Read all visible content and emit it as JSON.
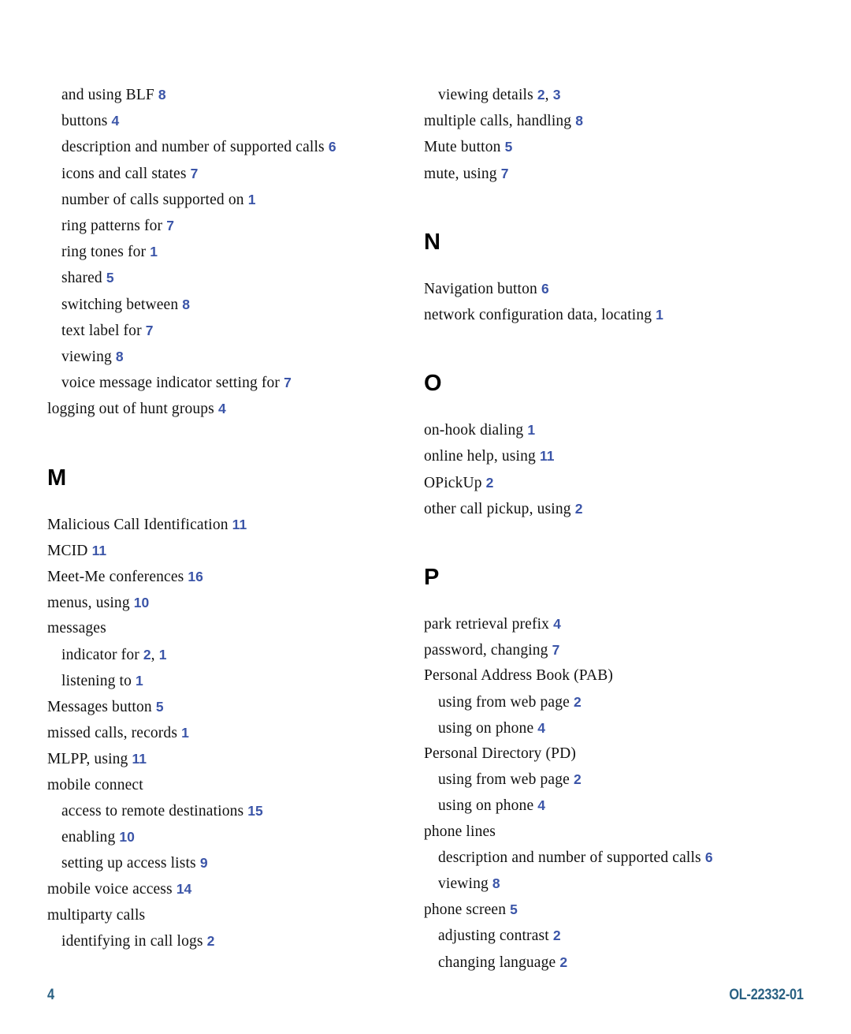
{
  "document": {
    "type": "index",
    "footer": {
      "page_number": "4",
      "document_id": "OL-22332-01"
    },
    "colors": {
      "page_reference": "#3b55a8",
      "footer": "#2a6183",
      "body_text": "#111111",
      "heading": "#000000"
    }
  },
  "columns": {
    "left": [
      {
        "kind": "entry",
        "level": 2,
        "term": "and using BLF",
        "refs": [
          "8"
        ]
      },
      {
        "kind": "entry",
        "level": 2,
        "term": "buttons",
        "refs": [
          "4"
        ]
      },
      {
        "kind": "entry",
        "level": 2,
        "term": "description and number of supported calls",
        "refs": [
          "6"
        ]
      },
      {
        "kind": "entry",
        "level": 2,
        "term": "icons and call states",
        "refs": [
          "7"
        ]
      },
      {
        "kind": "entry",
        "level": 2,
        "term": "number of calls supported on",
        "refs": [
          "1"
        ]
      },
      {
        "kind": "entry",
        "level": 2,
        "term": "ring patterns for",
        "refs": [
          "7"
        ]
      },
      {
        "kind": "entry",
        "level": 2,
        "term": "ring tones for",
        "refs": [
          "1"
        ]
      },
      {
        "kind": "entry",
        "level": 2,
        "term": "shared",
        "refs": [
          "5"
        ]
      },
      {
        "kind": "entry",
        "level": 2,
        "term": "switching between",
        "refs": [
          "8"
        ]
      },
      {
        "kind": "entry",
        "level": 2,
        "term": "text label for",
        "refs": [
          "7"
        ]
      },
      {
        "kind": "entry",
        "level": 2,
        "term": "viewing",
        "refs": [
          "8"
        ]
      },
      {
        "kind": "entry",
        "level": 2,
        "term": "voice message indicator setting for",
        "refs": [
          "7"
        ]
      },
      {
        "kind": "entry",
        "level": 1,
        "term": "logging out of hunt groups",
        "refs": [
          "4"
        ]
      },
      {
        "kind": "heading",
        "letter": "M"
      },
      {
        "kind": "entry",
        "level": 1,
        "term": "Malicious Call Identification",
        "refs": [
          "11"
        ]
      },
      {
        "kind": "entry",
        "level": 1,
        "term": "MCID",
        "refs": [
          "11"
        ]
      },
      {
        "kind": "entry",
        "level": 1,
        "term": "Meet-Me conferences",
        "refs": [
          "16"
        ]
      },
      {
        "kind": "entry",
        "level": 1,
        "term": "menus, using",
        "refs": [
          "10"
        ]
      },
      {
        "kind": "entry",
        "level": 1,
        "term": "messages",
        "refs": []
      },
      {
        "kind": "entry",
        "level": 2,
        "term": "indicator for",
        "refs": [
          "2",
          "1"
        ]
      },
      {
        "kind": "entry",
        "level": 2,
        "term": "listening to",
        "refs": [
          "1"
        ]
      },
      {
        "kind": "entry",
        "level": 1,
        "term": "Messages button",
        "refs": [
          "5"
        ]
      },
      {
        "kind": "entry",
        "level": 1,
        "term": "missed calls, records",
        "refs": [
          "1"
        ]
      },
      {
        "kind": "entry",
        "level": 1,
        "term": "MLPP, using",
        "refs": [
          "11"
        ]
      },
      {
        "kind": "entry",
        "level": 1,
        "term": "mobile connect",
        "refs": []
      },
      {
        "kind": "entry",
        "level": 2,
        "term": "access to remote destinations",
        "refs": [
          "15"
        ]
      },
      {
        "kind": "entry",
        "level": 2,
        "term": "enabling",
        "refs": [
          "10"
        ]
      },
      {
        "kind": "entry",
        "level": 2,
        "term": "setting up access lists",
        "refs": [
          "9"
        ]
      },
      {
        "kind": "entry",
        "level": 1,
        "term": "mobile voice access",
        "refs": [
          "14"
        ]
      },
      {
        "kind": "entry",
        "level": 1,
        "term": "multiparty calls",
        "refs": []
      },
      {
        "kind": "entry",
        "level": 2,
        "term": "identifying in call logs",
        "refs": [
          "2"
        ]
      }
    ],
    "right": [
      {
        "kind": "entry",
        "level": 2,
        "term": "viewing details",
        "refs": [
          "2",
          "3"
        ]
      },
      {
        "kind": "entry",
        "level": 1,
        "term": "multiple calls, handling",
        "refs": [
          "8"
        ]
      },
      {
        "kind": "entry",
        "level": 1,
        "term": "Mute button",
        "refs": [
          "5"
        ]
      },
      {
        "kind": "entry",
        "level": 1,
        "term": "mute, using",
        "refs": [
          "7"
        ]
      },
      {
        "kind": "heading",
        "letter": "N"
      },
      {
        "kind": "entry",
        "level": 1,
        "term": "Navigation button",
        "refs": [
          "6"
        ]
      },
      {
        "kind": "entry",
        "level": 1,
        "term": "network configuration data, locating",
        "refs": [
          "1"
        ]
      },
      {
        "kind": "heading",
        "letter": "O"
      },
      {
        "kind": "entry",
        "level": 1,
        "term": "on-hook dialing",
        "refs": [
          "1"
        ]
      },
      {
        "kind": "entry",
        "level": 1,
        "term": "online help, using",
        "refs": [
          "11"
        ]
      },
      {
        "kind": "entry",
        "level": 1,
        "term": "OPickUp",
        "refs": [
          "2"
        ]
      },
      {
        "kind": "entry",
        "level": 1,
        "term": "other call pickup, using",
        "refs": [
          "2"
        ]
      },
      {
        "kind": "heading",
        "letter": "P"
      },
      {
        "kind": "entry",
        "level": 1,
        "term": "park retrieval prefix",
        "refs": [
          "4"
        ]
      },
      {
        "kind": "entry",
        "level": 1,
        "term": "password, changing",
        "refs": [
          "7"
        ]
      },
      {
        "kind": "entry",
        "level": 1,
        "term": "Personal Address Book (PAB)",
        "refs": []
      },
      {
        "kind": "entry",
        "level": 2,
        "term": "using from web page",
        "refs": [
          "2"
        ]
      },
      {
        "kind": "entry",
        "level": 2,
        "term": "using on phone",
        "refs": [
          "4"
        ]
      },
      {
        "kind": "entry",
        "level": 1,
        "term": "Personal Directory (PD)",
        "refs": []
      },
      {
        "kind": "entry",
        "level": 2,
        "term": "using from web page",
        "refs": [
          "2"
        ]
      },
      {
        "kind": "entry",
        "level": 2,
        "term": "using on phone",
        "refs": [
          "4"
        ]
      },
      {
        "kind": "entry",
        "level": 1,
        "term": "phone lines",
        "refs": []
      },
      {
        "kind": "entry",
        "level": 2,
        "term": "description and number of supported calls",
        "refs": [
          "6"
        ]
      },
      {
        "kind": "entry",
        "level": 2,
        "term": "viewing",
        "refs": [
          "8"
        ]
      },
      {
        "kind": "entry",
        "level": 1,
        "term": "phone screen",
        "refs": [
          "5"
        ]
      },
      {
        "kind": "entry",
        "level": 2,
        "term": "adjusting contrast",
        "refs": [
          "2"
        ]
      },
      {
        "kind": "entry",
        "level": 2,
        "term": "changing language",
        "refs": [
          "2"
        ]
      }
    ]
  }
}
